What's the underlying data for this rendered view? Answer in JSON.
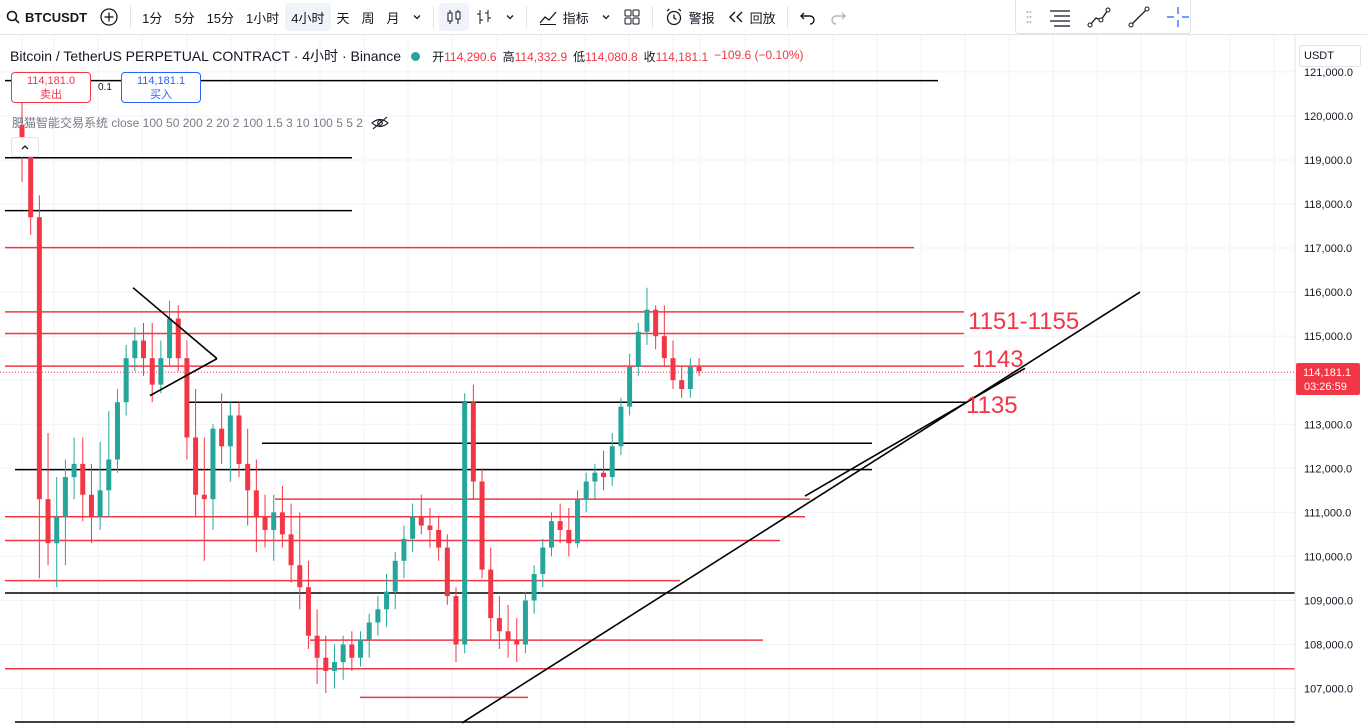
{
  "toolbar": {
    "symbol": "BTCUSDT",
    "intervals": [
      "1分",
      "5分",
      "15分",
      "1小时",
      "4小时",
      "天",
      "周",
      "月"
    ],
    "active_interval": "4小时",
    "indicators_label": "指标",
    "alert_label": "警报",
    "replay_label": "回放"
  },
  "legend": {
    "title": "Bitcoin / TetherUS PERPETUAL CONTRACT · 4小时 · Binance",
    "open_label": "开",
    "open": "114,290.6",
    "high_label": "高",
    "high": "114,332.9",
    "low_label": "低",
    "low": "114,080.8",
    "close_label": "收",
    "close": "114,181.1",
    "change": "−109.6 (−0.10%)"
  },
  "trade": {
    "sell_price": "114,181.0",
    "sell_label": "卖出",
    "spread": "0.1",
    "buy_price": "114,181.1",
    "buy_label": "买入"
  },
  "indicator_text": "肥猫智能交易系统 close 100 50 200 2 20 2 100 1.5 3 10 100 5 5 2",
  "currency": "USDT",
  "colors": {
    "up": "#26a69a",
    "down": "#f23645",
    "red_line": "#f23645",
    "black_line": "#000000",
    "annotation": "#f23645"
  },
  "chart_data": {
    "type": "candlestick",
    "y_axis_labels": [
      "121,000.0",
      "120,000.0",
      "119,000.0",
      "118,000.0",
      "117,000.0",
      "116,000.0",
      "115,000.0",
      "114,000.0",
      "113,000.0",
      "112,000.0",
      "111,000.0",
      "110,000.0",
      "109,000.0",
      "108,000.0",
      "107,000.0"
    ],
    "ylim": [
      106200,
      121300
    ],
    "last_price": "114,181.1",
    "countdown": "03:26:59",
    "annotations": [
      "1151-1155",
      "1143",
      "1135"
    ],
    "candles": [
      [
        119800,
        120300,
        118500,
        119300
      ],
      [
        119300,
        119500,
        117300,
        117700
      ],
      [
        117700,
        118200,
        109500,
        111300
      ],
      [
        111300,
        112800,
        109800,
        110300
      ],
      [
        110300,
        111800,
        109300,
        110900
      ],
      [
        110900,
        112200,
        109800,
        111800
      ],
      [
        111800,
        112700,
        111300,
        112100
      ],
      [
        112100,
        112700,
        110800,
        111400
      ],
      [
        111400,
        112100,
        110300,
        110900
      ],
      [
        110900,
        112600,
        110600,
        111500
      ],
      [
        111500,
        113300,
        110900,
        112200
      ],
      [
        112200,
        113800,
        111900,
        113500
      ],
      [
        113500,
        114800,
        113200,
        114500
      ],
      [
        114500,
        115200,
        114200,
        114900
      ],
      [
        114900,
        115300,
        114100,
        114500
      ],
      [
        114500,
        115300,
        113500,
        113900
      ],
      [
        113900,
        114900,
        113700,
        114500
      ],
      [
        114500,
        115800,
        114300,
        115400
      ],
      [
        115400,
        115700,
        114200,
        114500
      ],
      [
        114500,
        114900,
        112200,
        112700
      ],
      [
        112700,
        113800,
        110900,
        111400
      ],
      [
        111400,
        112700,
        109900,
        111300
      ],
      [
        111300,
        113000,
        110600,
        112900
      ],
      [
        112900,
        113700,
        112100,
        112500
      ],
      [
        112500,
        113500,
        111700,
        113200
      ],
      [
        113200,
        113500,
        111800,
        112100
      ],
      [
        112100,
        112900,
        110700,
        111500
      ],
      [
        111500,
        112200,
        110100,
        110900
      ],
      [
        110900,
        111400,
        110200,
        110600
      ],
      [
        110600,
        111400,
        109900,
        111000
      ],
      [
        111000,
        111600,
        110200,
        110500
      ],
      [
        110500,
        111200,
        109400,
        109800
      ],
      [
        109800,
        111000,
        108800,
        109300
      ],
      [
        109300,
        109900,
        107900,
        108200
      ],
      [
        108200,
        108800,
        107100,
        107700
      ],
      [
        107700,
        108200,
        106900,
        107400
      ],
      [
        107400,
        108000,
        107000,
        107600
      ],
      [
        107600,
        108200,
        107200,
        108000
      ],
      [
        108000,
        108300,
        107400,
        107700
      ],
      [
        107700,
        108300,
        107500,
        108100
      ],
      [
        108100,
        108700,
        107700,
        108500
      ],
      [
        108500,
        109100,
        108200,
        108800
      ],
      [
        108800,
        109600,
        108400,
        109200
      ],
      [
        109200,
        110100,
        108800,
        109900
      ],
      [
        109900,
        110700,
        109500,
        110400
      ],
      [
        110400,
        111200,
        110100,
        110900
      ],
      [
        110900,
        111400,
        110500,
        110700
      ],
      [
        110700,
        111100,
        110200,
        110600
      ],
      [
        110600,
        110900,
        109900,
        110200
      ],
      [
        110200,
        110500,
        108900,
        109100
      ],
      [
        109100,
        109300,
        107600,
        108000
      ],
      [
        108000,
        113700,
        107800,
        113500
      ],
      [
        113500,
        113900,
        111300,
        111700
      ],
      [
        111700,
        112000,
        109500,
        109700
      ],
      [
        109700,
        110200,
        108100,
        108600
      ],
      [
        108600,
        109100,
        107900,
        108300
      ],
      [
        108300,
        108900,
        107700,
        108100
      ],
      [
        108100,
        108600,
        107600,
        108000
      ],
      [
        108000,
        109200,
        107800,
        109000
      ],
      [
        109000,
        109800,
        108700,
        109600
      ],
      [
        109600,
        110400,
        109300,
        110200
      ],
      [
        110200,
        111000,
        110000,
        110800
      ],
      [
        110800,
        111200,
        110300,
        110600
      ],
      [
        110600,
        111100,
        110000,
        110300
      ],
      [
        110300,
        111500,
        110200,
        111300
      ],
      [
        111300,
        111900,
        111000,
        111700
      ],
      [
        111700,
        112100,
        111300,
        111900
      ],
      [
        111900,
        112400,
        111500,
        111800
      ],
      [
        111800,
        112800,
        111600,
        112500
      ],
      [
        112500,
        113600,
        112300,
        113400
      ],
      [
        113400,
        114600,
        113200,
        114300
      ],
      [
        114300,
        115300,
        114100,
        115100
      ],
      [
        115100,
        116100,
        114800,
        115600
      ],
      [
        115600,
        115700,
        114700,
        115000
      ],
      [
        115000,
        115700,
        114300,
        114500
      ],
      [
        114500,
        114900,
        113800,
        114000
      ],
      [
        114000,
        114300,
        113600,
        113800
      ],
      [
        113800,
        114500,
        113600,
        114300
      ],
      [
        114300,
        114500,
        114100,
        114200
      ]
    ]
  }
}
